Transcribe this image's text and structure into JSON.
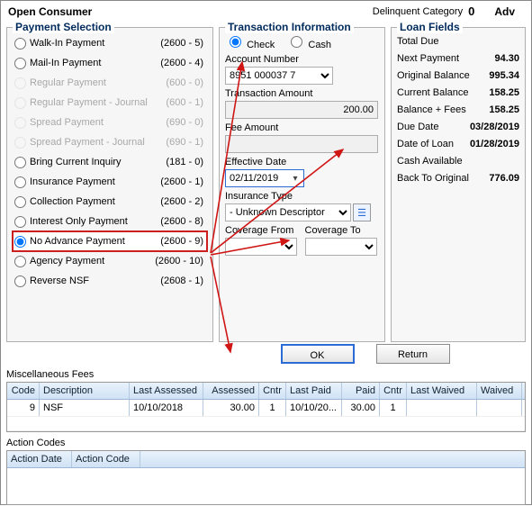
{
  "window": {
    "title": "Open Consumer",
    "delinquent_label": "Delinquent Category",
    "delinquent_value": "0",
    "adv": "Adv"
  },
  "paymentSelection": {
    "legend": "Payment Selection",
    "items": [
      {
        "label": "Walk-In Payment",
        "code": "(2600 - 5)",
        "disabled": false,
        "checked": false
      },
      {
        "label": "Mail-In Payment",
        "code": "(2600 - 4)",
        "disabled": false,
        "checked": false
      },
      {
        "label": "Regular Payment",
        "code": "(600 - 0)",
        "disabled": true,
        "checked": false
      },
      {
        "label": "Regular Payment - Journal",
        "code": "(600 - 1)",
        "disabled": true,
        "checked": false
      },
      {
        "label": "Spread Payment",
        "code": "(690 - 0)",
        "disabled": true,
        "checked": false
      },
      {
        "label": "Spread Payment - Journal",
        "code": "(690 - 1)",
        "disabled": true,
        "checked": false
      },
      {
        "label": "Bring Current Inquiry",
        "code": "(181 - 0)",
        "disabled": false,
        "checked": false
      },
      {
        "label": "Insurance Payment",
        "code": "(2600 - 1)",
        "disabled": false,
        "checked": false
      },
      {
        "label": "Collection Payment",
        "code": "(2600 - 2)",
        "disabled": false,
        "checked": false
      },
      {
        "label": "Interest Only Payment",
        "code": "(2600 - 8)",
        "disabled": false,
        "checked": false
      },
      {
        "label": "No Advance Payment",
        "code": "(2600 - 9)",
        "disabled": false,
        "checked": true
      },
      {
        "label": "Agency Payment",
        "code": "(2600 - 10)",
        "disabled": false,
        "checked": false
      },
      {
        "label": "Reverse NSF",
        "code": "(2608 - 1)",
        "disabled": false,
        "checked": false
      }
    ]
  },
  "txn": {
    "legend": "Transaction Information",
    "check_label": "Check",
    "cash_label": "Cash",
    "payment_method": "check",
    "account_label": "Account Number",
    "account_value": "8951 000037 7",
    "amount_label": "Transaction Amount",
    "amount_value": "200.00",
    "fee_label": "Fee Amount",
    "fee_value": "",
    "effdate_label": "Effective Date",
    "effdate_value": "02/11/2019",
    "ins_label": "Insurance Type",
    "ins_value": "- Unknown Descriptor",
    "cov_from_label": "Coverage From",
    "cov_to_label": "Coverage To"
  },
  "loan": {
    "legend": "Loan Fields",
    "rows": [
      {
        "label": "Total Due",
        "value": ""
      },
      {
        "label": "Next Payment",
        "value": "94.30"
      },
      {
        "label": "Original Balance",
        "value": "995.34"
      },
      {
        "label": "Current Balance",
        "value": "158.25"
      },
      {
        "label": "Balance + Fees",
        "value": "158.25"
      },
      {
        "label": "Due Date",
        "value": "03/28/2019"
      },
      {
        "label": "Date of Loan",
        "value": "01/28/2019"
      },
      {
        "label": "Cash Available",
        "value": ""
      },
      {
        "label": "Back To Original",
        "value": "776.09"
      }
    ]
  },
  "buttons": {
    "ok": "OK",
    "return": "Return"
  },
  "misc": {
    "title": "Miscellaneous Fees",
    "headers": {
      "code": "Code",
      "desc": "Description",
      "la": "Last Assessed",
      "ass": "Assessed",
      "cntr": "Cntr",
      "lp": "Last Paid",
      "paid": "Paid",
      "cntr2": "Cntr",
      "lw": "Last Waived",
      "wv": "Waived"
    },
    "rows": [
      {
        "code": "9",
        "desc": "NSF",
        "la": "10/10/2018",
        "ass": "30.00",
        "cntr": "1",
        "lp": "10/10/20...",
        "paid": "30.00",
        "cntr2": "1",
        "lw": "",
        "wv": ""
      }
    ]
  },
  "actions": {
    "title": "Action Codes",
    "headers": {
      "ad": "Action Date",
      "ac": "Action Code"
    }
  }
}
